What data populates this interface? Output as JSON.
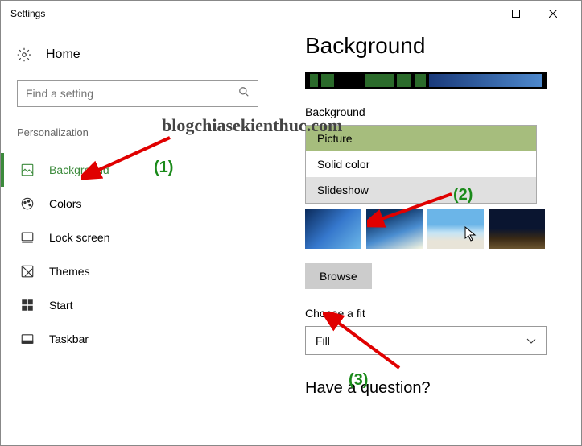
{
  "window": {
    "title": "Settings"
  },
  "sidebar": {
    "home": "Home",
    "search_placeholder": "Find a setting",
    "section": "Personalization",
    "items": [
      {
        "label": "Background"
      },
      {
        "label": "Colors"
      },
      {
        "label": "Lock screen"
      },
      {
        "label": "Themes"
      },
      {
        "label": "Start"
      },
      {
        "label": "Taskbar"
      }
    ]
  },
  "main": {
    "title": "Background",
    "bg_label": "Background",
    "dropdown": {
      "options": [
        "Picture",
        "Solid color",
        "Slideshow"
      ],
      "selected": "Picture"
    },
    "browse": "Browse",
    "fit_label": "Choose a fit",
    "fit_value": "Fill",
    "question": "Have a question?"
  },
  "annotations": {
    "watermark": "blogchiasekienthuc.com",
    "labels": [
      "(1)",
      "(2)",
      "(3)"
    ]
  }
}
